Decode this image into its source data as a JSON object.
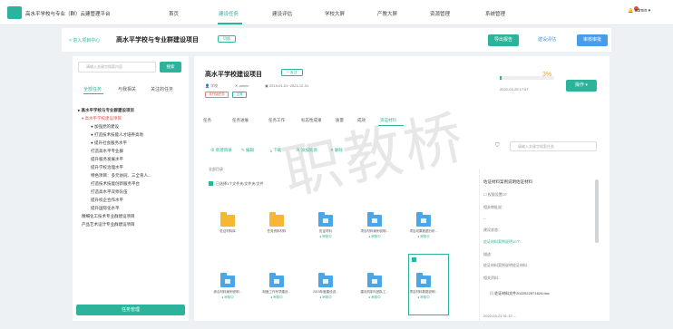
{
  "topnav": {
    "app_name": "高水平学校与专业（群）云建管理平台",
    "items": [
      "首页",
      "建设任务",
      "建设评估",
      "学校大屏",
      "产教大屏",
      "资源管理",
      "系统管理"
    ],
    "user": "admin"
  },
  "header": {
    "back": "< 进入项目中心",
    "title": "高水平学校与专业群建设项目",
    "switch_tag": "切换",
    "btn_export": "导出报告",
    "btn_eval": "建设评估",
    "btn_mgmt": "审核审批"
  },
  "left": {
    "search_placeholder": "请输入关键字搜索内容",
    "search_btn": "搜索",
    "tabs": [
      "全部任务",
      "与我相关",
      "关注的任务"
    ],
    "tree": [
      "▸ 高水平学校与专业群建设项目",
      "▾ 高水平学校建设项目",
      "● 加强党的建设",
      "● 打造技术技能人才培养高地",
      "● 提升社会服务水平",
      "打造高水平专业群",
      "提升服务发展水平",
      "提升学校治理水平",
      "特色项目：多元协同、三全育人...",
      "打造技术技能创新服务平台",
      "打造高水平双师队伍",
      "提升校企合作水平",
      "提升国际化水平",
      "精细化工技术专业群建设项目",
      "产品艺术设计专业群建设项目"
    ],
    "bottom_btn": "任务管理"
  },
  "right": {
    "title": "高水平学校建设项目",
    "follow": "+ 关注",
    "owner": "学校",
    "creator": "admin",
    "date": "2019-01-01~2023-12-31",
    "tag_red": "未开始任务",
    "tag_green": "正常",
    "percent": "3%",
    "progress_fraction": 0.03,
    "updated": "2022-03-25 17:57",
    "action_btn": "操作 ▾",
    "tabs": [
      "任务",
      "任务进展",
      "任务工作",
      "标志性成果",
      "质量",
      "成效",
      "资证材料"
    ],
    "toolbar": [
      "⊕ 新建目录",
      "✎ 编辑",
      "⤓ 下载",
      "⊕ 添加资源",
      "✕ 删除"
    ],
    "crumb": "全部目录",
    "select_all": "已选择1个文件夹/文件夹/文件",
    "folders_row1": [
      {
        "name": "佐证材料库",
        "sub": ""
      },
      {
        "name": "任务资料材料",
        "sub": ""
      },
      {
        "name": "佐证材料",
        "sub": "● 审核中"
      },
      {
        "name": "项目材料案例说明...",
        "sub": "● 审核中"
      },
      {
        "name": "项目成果数据分析...",
        "sub": "● 审核中"
      }
    ],
    "folders_row2": [
      {
        "name": "综合材料案例说明...",
        "sub": "● 审核中"
      },
      {
        "name": "制度工作专项建设...",
        "sub": "● 审核中"
      },
      {
        "name": "2019年度建设说...",
        "sub": "● 审核中"
      },
      {
        "name": "建设机制与团队工...",
        "sub": "● 审核中"
      },
      {
        "name": "项目材料数据说明...",
        "sub": "● 审核中"
      }
    ],
    "side_search": "请输入关键字搜索任务",
    "side": {
      "title": "佐证材料案例说明佐证材料",
      "l1": "☐ 权限设置OT",
      "l2": "相关审批说：",
      "l3": "--",
      "l4": "建设状态：",
      "l5": "佐证材料案例说明10个",
      "l6": "描述：",
      "l7": "佐证材料案例说明佐证材料",
      "l8": "相关资料：",
      "file": "佐证材料文件20220225T1624.doc",
      "ts": "2022-03-21 01:12:..."
    }
  },
  "watermark": "职教桥"
}
